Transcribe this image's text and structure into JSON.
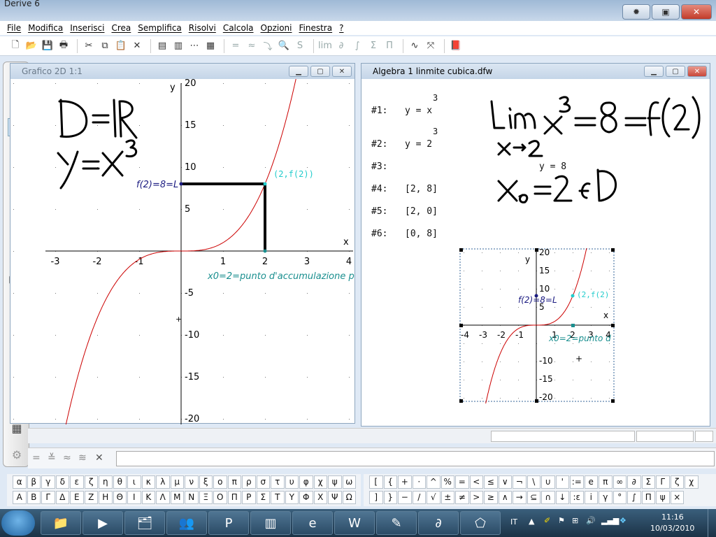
{
  "window": {
    "title": "Derive 6"
  },
  "menu": [
    "File",
    "Modifica",
    "Inserisci",
    "Crea",
    "Semplifica",
    "Risolvi",
    "Calcola",
    "Opzioni",
    "Finestra",
    "?"
  ],
  "graph_window": {
    "title": "Grafico 2D 1:1",
    "x_axis_label": "x",
    "y_axis_label": "y",
    "x_ticks": [
      "-3",
      "-2",
      "-1",
      "1",
      "2",
      "3",
      "4"
    ],
    "y_ticks": [
      "20",
      "15",
      "10",
      "5",
      "-5",
      "-10",
      "-15",
      "-20"
    ],
    "point_label": "(2,f(2))",
    "fx_label": "f(2)=8=L",
    "x0_label": "x0=2=punto d'accumulazione p"
  },
  "algebra_window": {
    "title": "Algebra 1  linmite cubica.dfw",
    "expressions": [
      {
        "num": "#1:",
        "expr": "y = x",
        "exp": "3"
      },
      {
        "num": "#2:",
        "expr": "y = 2",
        "exp": "3"
      },
      {
        "num": "#3:",
        "expr": "y = 8",
        "exp": ""
      },
      {
        "num": "#4:",
        "expr": "[2, 8]",
        "exp": ""
      },
      {
        "num": "#5:",
        "expr": "[2, 0]",
        "exp": ""
      },
      {
        "num": "#6:",
        "expr": "[0, 8]",
        "exp": ""
      }
    ],
    "embedded_plot": {
      "x_axis_label": "x",
      "y_axis_label": "y",
      "x_ticks": [
        "-4",
        "-3",
        "-2",
        "-1",
        "1",
        "2",
        "3",
        "4"
      ],
      "y_ticks": [
        "20",
        "15",
        "10",
        "5",
        "-10",
        "-15",
        "-20"
      ],
      "point_label": "(2,f(2)",
      "fx_label": "f(2)=8=L",
      "x0_label": "x0=2=punto d"
    }
  },
  "greek_row1": [
    "α",
    "β",
    "γ",
    "δ",
    "ε",
    "ζ",
    "η",
    "θ",
    "ι",
    "κ",
    "λ",
    "μ",
    "ν",
    "ξ",
    "ο",
    "π",
    "ρ",
    "σ",
    "τ",
    "υ",
    "φ",
    "χ",
    "ψ",
    "ω"
  ],
  "greek_row2": [
    "Α",
    "Β",
    "Γ",
    "Δ",
    "Ε",
    "Ζ",
    "Η",
    "Θ",
    "Ι",
    "Κ",
    "Λ",
    "Μ",
    "Ν",
    "Ξ",
    "Ο",
    "Π",
    "Ρ",
    "Σ",
    "Τ",
    "Υ",
    "Φ",
    "Χ",
    "Ψ",
    "Ω"
  ],
  "symbols_row1": [
    "[",
    "{",
    "+",
    "·",
    "^",
    "%",
    "=",
    "<",
    "≤",
    "∨",
    "¬",
    "\\",
    "∪",
    "'",
    ":=",
    "e",
    "π",
    "∞",
    "∂",
    "Σ",
    "Γ",
    "ζ",
    "χ"
  ],
  "symbols_row2": [
    "]",
    "}",
    "−",
    "/",
    "√",
    "±",
    "≠",
    ">",
    "≥",
    "∧",
    "→",
    "⊆",
    "∩",
    "↓",
    ":ε",
    "i",
    "γ",
    "°",
    "∫",
    "Π",
    "ψ",
    "×"
  ],
  "taskbar": {
    "lang": "IT",
    "time": "11:16",
    "date": "10/03/2010"
  },
  "colors": {
    "curve": "#cc0000",
    "point": "#22cccc",
    "label_blue": "#1a1a80",
    "label_teal": "#1a8f8f"
  }
}
